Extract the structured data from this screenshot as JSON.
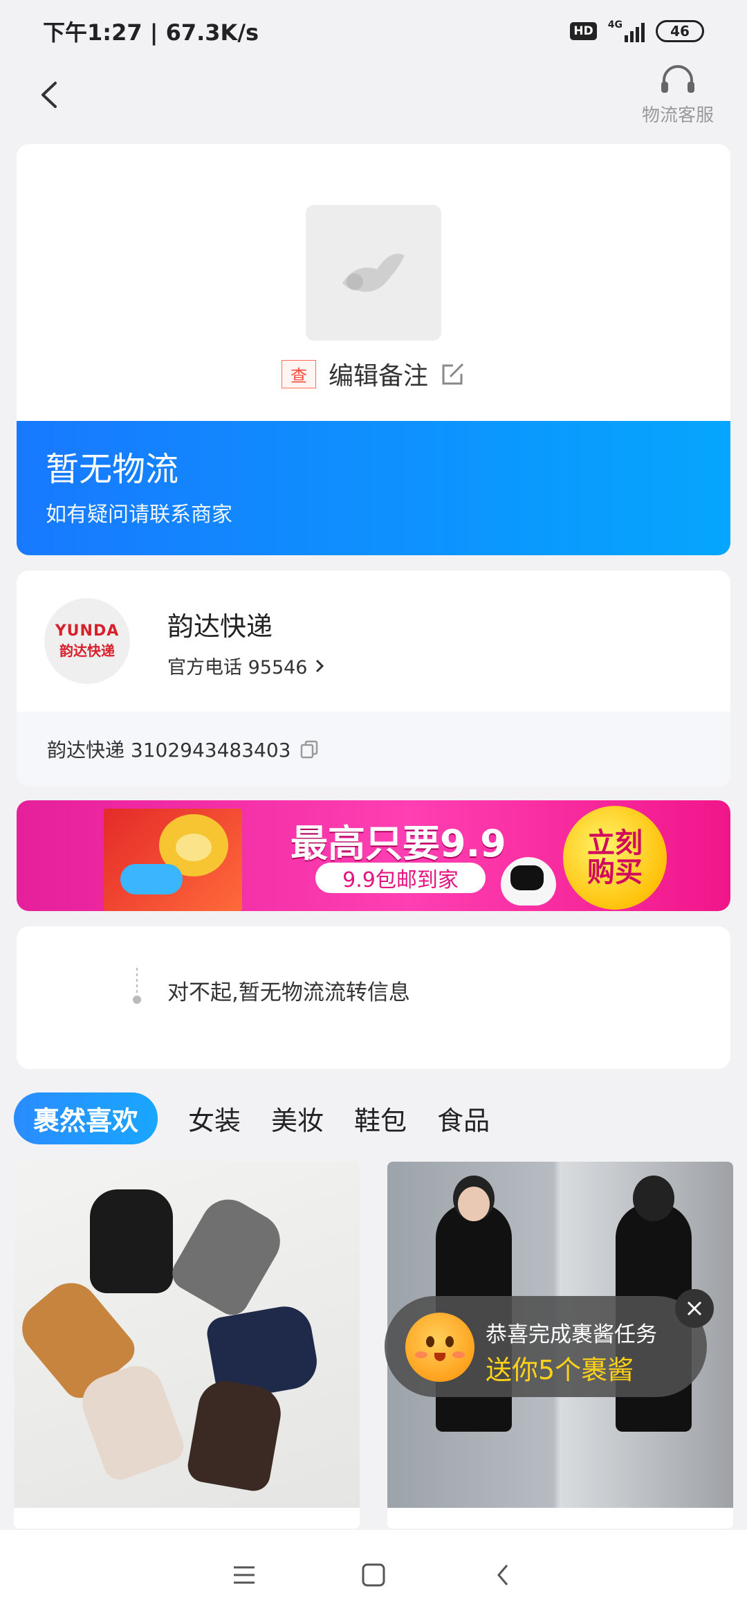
{
  "status_bar": {
    "time_speed": "下午1:27 | 67.3K/s",
    "hd": "HD",
    "network": "4G",
    "battery": "46"
  },
  "header": {
    "back_icon": "chevron-left-icon",
    "customer_service_label": "物流客服",
    "customer_service_icon": "headset-icon"
  },
  "order": {
    "check_tag": "查",
    "edit_note": "编辑备注",
    "edit_icon": "edit-icon",
    "status_title": "暂无物流",
    "status_sub": "如有疑问请联系商家"
  },
  "courier": {
    "logo_en": "YUNDA",
    "logo_cn": "韵达快递",
    "name": "韵达快递",
    "phone": "官方电话 95546",
    "tracking": "韵达快递 3102943483403",
    "copy_icon": "copy-icon"
  },
  "promo": {
    "headline": "最高只要9.9",
    "pill": "9.9包邮到家",
    "buy_button": "立刻购买"
  },
  "tracking_message": "对不起,暂无物流流转信息",
  "tabs": [
    {
      "label": "裹然喜欢"
    },
    {
      "label": "女装"
    },
    {
      "label": "美妆"
    },
    {
      "label": "鞋包"
    },
    {
      "label": "食品"
    }
  ],
  "toast": {
    "line1": "恭喜完成裹酱任务",
    "line2": "送你5个裹酱",
    "close_icon": "close-icon"
  },
  "nav": {
    "menu_icon": "menu-icon",
    "home_icon": "home-icon",
    "back_icon": "back-icon"
  },
  "colors": {
    "accent_blue": "#1a8cff",
    "promo_pink": "#ff3fb2",
    "toast_yellow": "#ffd21a"
  }
}
